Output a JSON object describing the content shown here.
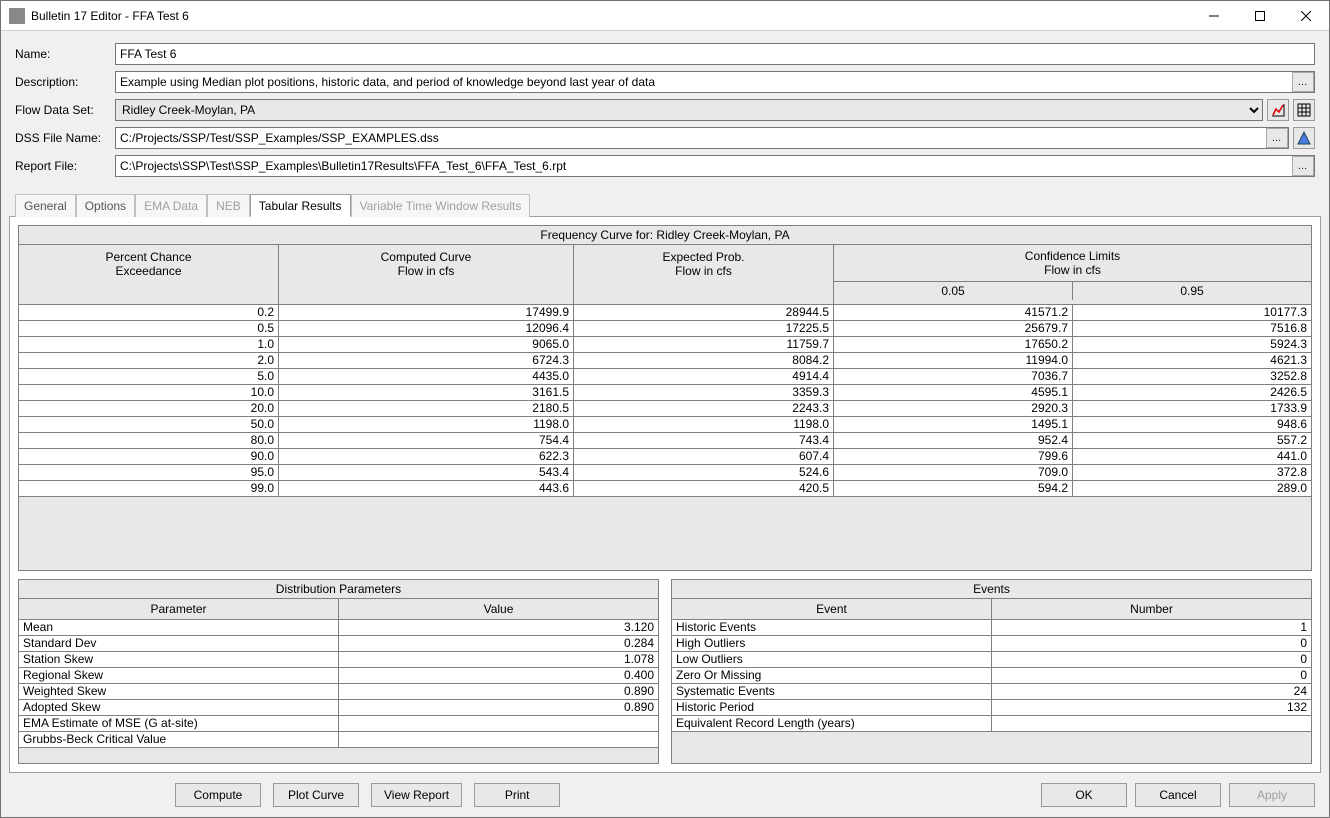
{
  "window": {
    "title": "Bulletin 17 Editor - FFA Test 6"
  },
  "form": {
    "name_label": "Name:",
    "name_value": "FFA Test 6",
    "desc_label": "Description:",
    "desc_value": "Example using Median plot positions, historic data, and period of knowledge beyond last year of data",
    "flow_label": "Flow Data Set:",
    "flow_value": "Ridley Creek-Moylan, PA",
    "dss_label": "DSS File Name:",
    "dss_value": "C:/Projects/SSP/Test/SSP_Examples/SSP_EXAMPLES.dss",
    "report_label": "Report File:",
    "report_value": "C:\\Projects\\SSP\\Test\\SSP_Examples\\Bulletin17Results\\FFA_Test_6\\FFA_Test_6.rpt"
  },
  "tabs": {
    "general": "General",
    "options": "Options",
    "ema": "EMA Data",
    "neb": "NEB",
    "tabular": "Tabular Results",
    "varwin": "Variable Time Window Results"
  },
  "freq": {
    "title": "Frequency Curve for: Ridley Creek-Moylan, PA",
    "col0a": "Percent Chance",
    "col0b": "Exceedance",
    "col1a": "Computed Curve",
    "col1b": "Flow in cfs",
    "col2a": "Expected Prob.",
    "col2b": "Flow in cfs",
    "col3a": "Confidence Limits",
    "col3b": "Flow in cfs",
    "sub0": "0.05",
    "sub1": "0.95",
    "rows": [
      {
        "p": "0.2",
        "c": "17499.9",
        "e": "28944.5",
        "l": "41571.2",
        "u": "10177.3"
      },
      {
        "p": "0.5",
        "c": "12096.4",
        "e": "17225.5",
        "l": "25679.7",
        "u": "7516.8"
      },
      {
        "p": "1.0",
        "c": "9065.0",
        "e": "11759.7",
        "l": "17650.2",
        "u": "5924.3"
      },
      {
        "p": "2.0",
        "c": "6724.3",
        "e": "8084.2",
        "l": "11994.0",
        "u": "4621.3"
      },
      {
        "p": "5.0",
        "c": "4435.0",
        "e": "4914.4",
        "l": "7036.7",
        "u": "3252.8"
      },
      {
        "p": "10.0",
        "c": "3161.5",
        "e": "3359.3",
        "l": "4595.1",
        "u": "2426.5"
      },
      {
        "p": "20.0",
        "c": "2180.5",
        "e": "2243.3",
        "l": "2920.3",
        "u": "1733.9"
      },
      {
        "p": "50.0",
        "c": "1198.0",
        "e": "1198.0",
        "l": "1495.1",
        "u": "948.6"
      },
      {
        "p": "80.0",
        "c": "754.4",
        "e": "743.4",
        "l": "952.4",
        "u": "557.2"
      },
      {
        "p": "90.0",
        "c": "622.3",
        "e": "607.4",
        "l": "799.6",
        "u": "441.0"
      },
      {
        "p": "95.0",
        "c": "543.4",
        "e": "524.6",
        "l": "709.0",
        "u": "372.8"
      },
      {
        "p": "99.0",
        "c": "443.6",
        "e": "420.5",
        "l": "594.2",
        "u": "289.0"
      }
    ]
  },
  "dist": {
    "title": "Distribution Parameters",
    "h0": "Parameter",
    "h1": "Value",
    "rows": [
      {
        "k": "Mean",
        "v": "3.120"
      },
      {
        "k": "Standard Dev",
        "v": "0.284"
      },
      {
        "k": "Station Skew",
        "v": "1.078"
      },
      {
        "k": "Regional Skew",
        "v": "0.400"
      },
      {
        "k": "Weighted Skew",
        "v": "0.890"
      },
      {
        "k": "Adopted Skew",
        "v": "0.890"
      },
      {
        "k": "EMA Estimate of MSE (G at-site)",
        "v": ""
      },
      {
        "k": "Grubbs-Beck Critical Value",
        "v": ""
      }
    ]
  },
  "events": {
    "title": "Events",
    "h0": "Event",
    "h1": "Number",
    "rows": [
      {
        "k": "Historic Events",
        "v": "1"
      },
      {
        "k": "High Outliers",
        "v": "0"
      },
      {
        "k": "Low Outliers",
        "v": "0"
      },
      {
        "k": "Zero Or Missing",
        "v": "0"
      },
      {
        "k": "Systematic Events",
        "v": "24"
      },
      {
        "k": "Historic Period",
        "v": "132"
      },
      {
        "k": "Equivalent Record Length (years)",
        "v": ""
      }
    ]
  },
  "buttons": {
    "compute": "Compute",
    "plot": "Plot Curve",
    "view": "View Report",
    "print": "Print",
    "ok": "OK",
    "cancel": "Cancel",
    "apply": "Apply"
  }
}
